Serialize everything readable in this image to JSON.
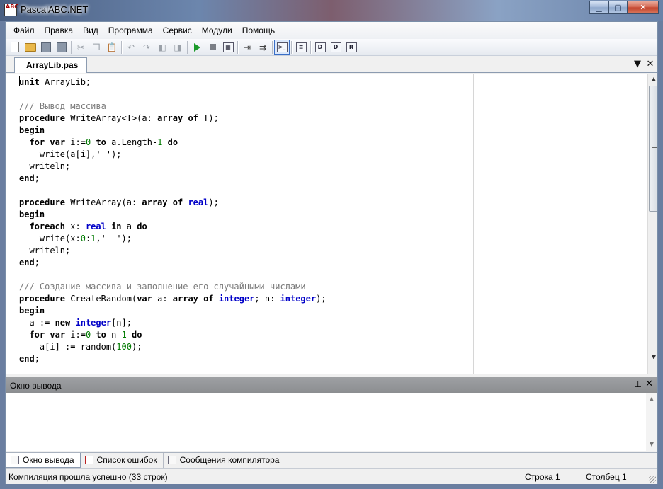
{
  "window": {
    "title": "PascalABC.NET",
    "icon_text": "ABC"
  },
  "menu": [
    "Файл",
    "Правка",
    "Вид",
    "Программа",
    "Сервис",
    "Модули",
    "Помощь"
  ],
  "toolbar": {
    "icons": [
      "new-file-icon",
      "open-folder-icon",
      "save-icon",
      "save-all-icon",
      "cut-icon",
      "copy-icon",
      "paste-icon",
      "undo-icon",
      "redo-icon",
      "nav-back-icon",
      "nav-forward-icon",
      "run-icon",
      "stop-icon",
      "compile-icon",
      "debug-step-icon",
      "debug-step-over-icon",
      "output-window-icon",
      "format-icon",
      "db-d-icon",
      "db-r-icon"
    ]
  },
  "tabs": {
    "active": "ArrayLib.pas",
    "dropdown": "▼",
    "close": "✕"
  },
  "editor": {
    "lines": [
      "unit ArrayLib;",
      "",
      "/// Вывод массива",
      "procedure WriteArray<T>(a: array of T);",
      "begin",
      "  for var i:=0 to a.Length-1 do",
      "    write(a[i],' ');",
      "  writeln;",
      "end;",
      "",
      "procedure WriteArray(a: array of real);",
      "begin",
      "  foreach x: real in a do",
      "    write(x:0:1,'  ');",
      "  writeln;",
      "end;",
      "",
      "/// Создание массива и заполнение его случайными числами",
      "procedure CreateRandom(var a: array of integer; n: integer);",
      "begin",
      "  a := new integer[n];",
      "  for var i:=0 to n-1 do",
      "    a[i] := random(100);",
      "end;"
    ]
  },
  "output": {
    "title": "Окно вывода",
    "pin": "ᵖ",
    "close": "✕"
  },
  "bottom_tabs": [
    "Окно вывода",
    "Список ошибок",
    "Сообщения компилятора"
  ],
  "status": {
    "message": "Компиляция прошла успешно (33 строк)",
    "row_label": "Строка  1",
    "col_label": "Столбец  1"
  },
  "colors": {
    "keyword": "#000000",
    "type": "#0000c8",
    "comment": "#7a7a7a",
    "number": "#007a00"
  }
}
